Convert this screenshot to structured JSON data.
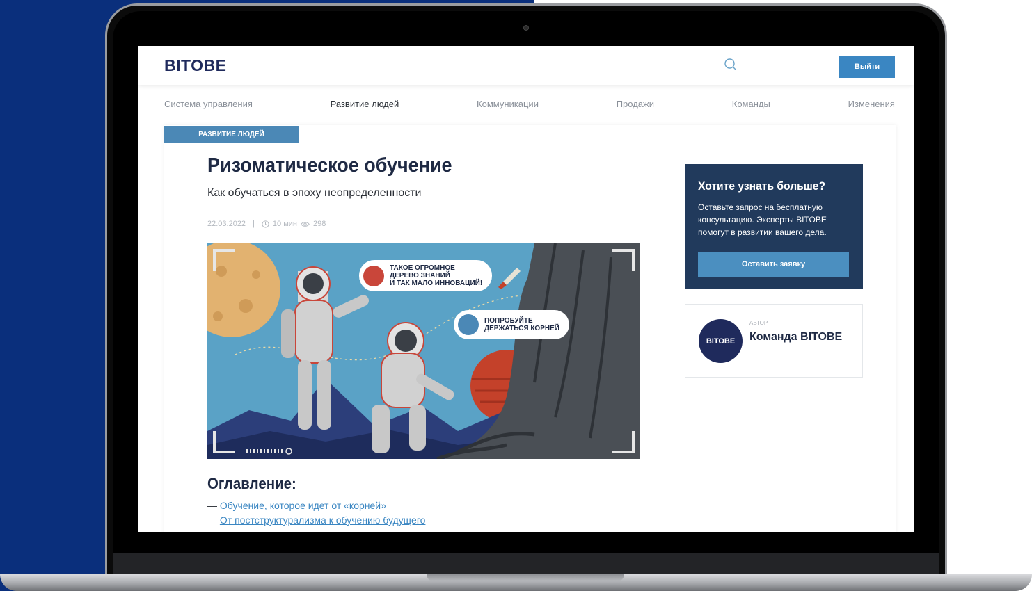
{
  "header": {
    "logo": "BITOBE",
    "logout_label": "Выйти"
  },
  "nav": {
    "items": [
      {
        "label": "Система управления",
        "active": false
      },
      {
        "label": "Развитие людей",
        "active": true
      },
      {
        "label": "Коммуникации",
        "active": false
      },
      {
        "label": "Продажи",
        "active": false
      },
      {
        "label": "Команды",
        "active": false
      },
      {
        "label": "Изменения",
        "active": false
      }
    ]
  },
  "article": {
    "category": "РАЗВИТИЕ ЛЮДЕЙ",
    "title": "Ризоматическое обучение",
    "subtitle": "Как обучаться в эпоху неопределенности",
    "date": "22.03.2022",
    "read_time": "10 мин",
    "views": "298",
    "hero": {
      "bubble_1": "ТАКОЕ ОГРОМНОЕ\nДЕРЕВО ЗНАНИЙ\nИ ТАК МАЛО ИННОВАЦИЙ!",
      "bubble_2": "ПОПРОБУЙТЕ\nДЕРЖАТЬСЯ КОРНЕЙ"
    },
    "toc_title": "Оглавление:",
    "toc": [
      {
        "dash": "— ",
        "link": "Обучение, которое идет от «корней»"
      },
      {
        "dash": "— ",
        "link": "От постструктурализма к обучению будущего"
      }
    ]
  },
  "cta": {
    "title": "Хотите узнать больше?",
    "text": "Оставьте запрос на бесплатную консультацию. Эксперты BITOBE помогут в развитии вашего дела.",
    "button": "Оставить заявку"
  },
  "author": {
    "label": "АВТОР",
    "name": "Команда BITOBE",
    "avatar_text": "BITOBE"
  },
  "colors": {
    "brand_navy": "#1f2a5c",
    "accent_blue": "#3a86c2",
    "cta_bg": "#213a5c",
    "page_bg_left": "#0a2f7c"
  }
}
